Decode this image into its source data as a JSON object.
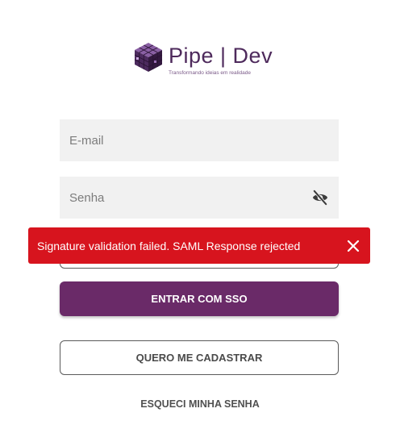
{
  "logo": {
    "title": "Pipe | Dev",
    "tagline": "Transformando ideias em realidade",
    "icon": "cube-logo-icon"
  },
  "form": {
    "email_placeholder": "E-mail",
    "password_placeholder": "Senha",
    "toggle_visibility_icon": "eye-slash-icon"
  },
  "toast": {
    "message": "Signature validation failed. SAML Response rejected",
    "close_icon": "close-icon",
    "color": "#d7141e"
  },
  "buttons": {
    "sso_label": "ENTRAR COM SSO",
    "register_label": "QUERO ME CADASTRAR",
    "forgot_label": "ESQUECI MINHA SENHA"
  },
  "colors": {
    "brand": "#6a2a68",
    "input_bg": "#f1f1f1"
  }
}
